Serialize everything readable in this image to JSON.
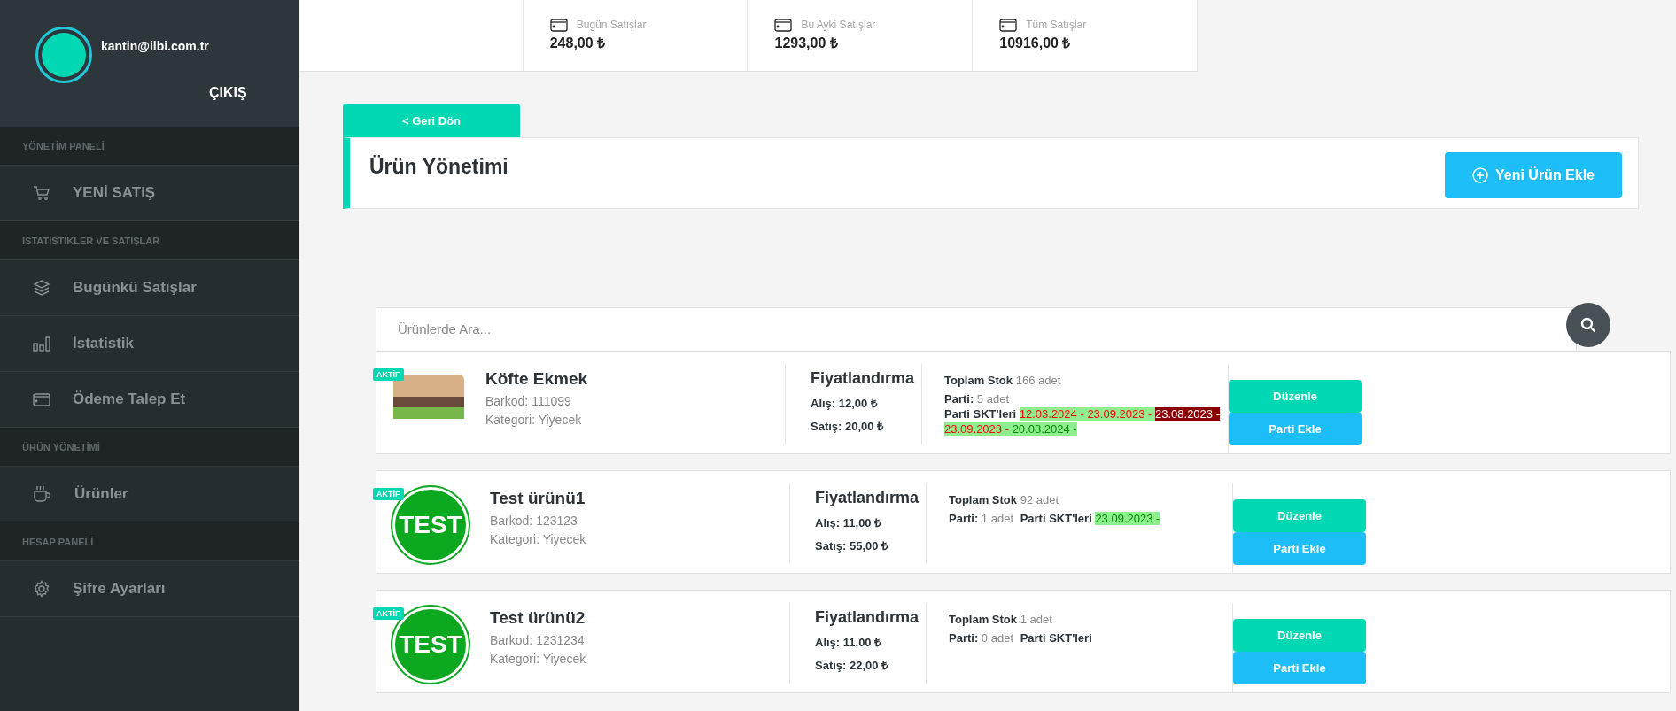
{
  "sidebar": {
    "user_email": "kantin@ilbi.com.tr",
    "logout": "ÇIKIŞ",
    "sections": [
      {
        "heading": "YÖNETİM PANELİ",
        "items": [
          {
            "label": "YENİ SATIŞ"
          }
        ]
      },
      {
        "heading": "İSTATİSTİKLER VE SATIŞLAR",
        "items": [
          {
            "label": "Bugünkü Satışlar"
          },
          {
            "label": "İstatistik"
          },
          {
            "label": "Ödeme Talep Et"
          }
        ]
      },
      {
        "heading": "ÜRÜN YÖNETİMİ",
        "items": [
          {
            "label": "Ürünler"
          }
        ]
      },
      {
        "heading": "HESAP PANELİ",
        "items": [
          {
            "label": "Şifre Ayarları"
          }
        ]
      }
    ]
  },
  "stats": [
    {
      "label": "Bugün Satışlar",
      "value": "248,00 ₺"
    },
    {
      "label": "Bu Ayki Satışlar",
      "value": "1293,00 ₺"
    },
    {
      "label": "Tüm Satışlar",
      "value": "10916,00 ₺"
    }
  ],
  "back_button": "< Geri Dön",
  "page_title": "Ürün Yönetimi",
  "add_button": "Yeni Ürün Ekle",
  "search": {
    "placeholder": "Ürünlerde Ara..."
  },
  "products": [
    {
      "status": "AKTİF",
      "kind": "photo",
      "name": "Köfte Ekmek",
      "barcode": "Barkod: 111099",
      "category": "Kategori: Yiyecek",
      "pricing_title": "Fiyatlandırma",
      "buy": "Alış: 12,00 ₺",
      "sell": "Satış: 20,00 ₺",
      "stock_label": "Toplam Stok",
      "stock_value": "166 adet",
      "batch_label": "Parti:",
      "batch_value": "5 adet",
      "expiry_label": "Parti SKT'leri",
      "expiry_dates": [
        {
          "text": "12.03.2024 - ",
          "kind": "near"
        },
        {
          "text": "23.09.2023 - ",
          "kind": "near"
        },
        {
          "text": "23.08.2023 -",
          "kind": "expired"
        },
        {
          "text": " 23.09.2023 - ",
          "kind": "near"
        },
        {
          "text": "20.08.2024 - ",
          "kind": "ok"
        }
      ],
      "edit_button": "Düzenle",
      "batch_button": "Parti Ekle"
    },
    {
      "status": "AKTİF",
      "kind": "logo",
      "logo_text": "TEST",
      "name": "Test ürünü1",
      "barcode": "Barkod: 123123",
      "category": "Kategori: Yiyecek",
      "pricing_title": "Fiyatlandırma",
      "buy": "Alış: 11,00 ₺",
      "sell": "Satış: 55,00 ₺",
      "stock_label": "Toplam Stok",
      "stock_value": "92 adet",
      "batch_label": "Parti:",
      "batch_value": "1 adet",
      "expiry_label": "Parti SKT'leri",
      "expiry_dates": [
        {
          "text": "23.09.2023 - ",
          "kind": "ok"
        }
      ],
      "edit_button": "Düzenle",
      "batch_button": "Parti Ekle"
    },
    {
      "status": "AKTİF",
      "kind": "logo",
      "logo_text": "TEST",
      "name": "Test ürünü2",
      "barcode": "Barkod: 1231234",
      "category": "Kategori: Yiyecek",
      "pricing_title": "Fiyatlandırma",
      "buy": "Alış: 11,00 ₺",
      "sell": "Satış: 22,00 ₺",
      "stock_label": "Toplam Stok",
      "stock_value": "1 adet",
      "batch_label": "Parti:",
      "batch_value": "0 adet",
      "expiry_label": "Parti SKT'leri",
      "edit_button": "Düzenle",
      "batch_button": "Parti Ekle"
    }
  ]
}
